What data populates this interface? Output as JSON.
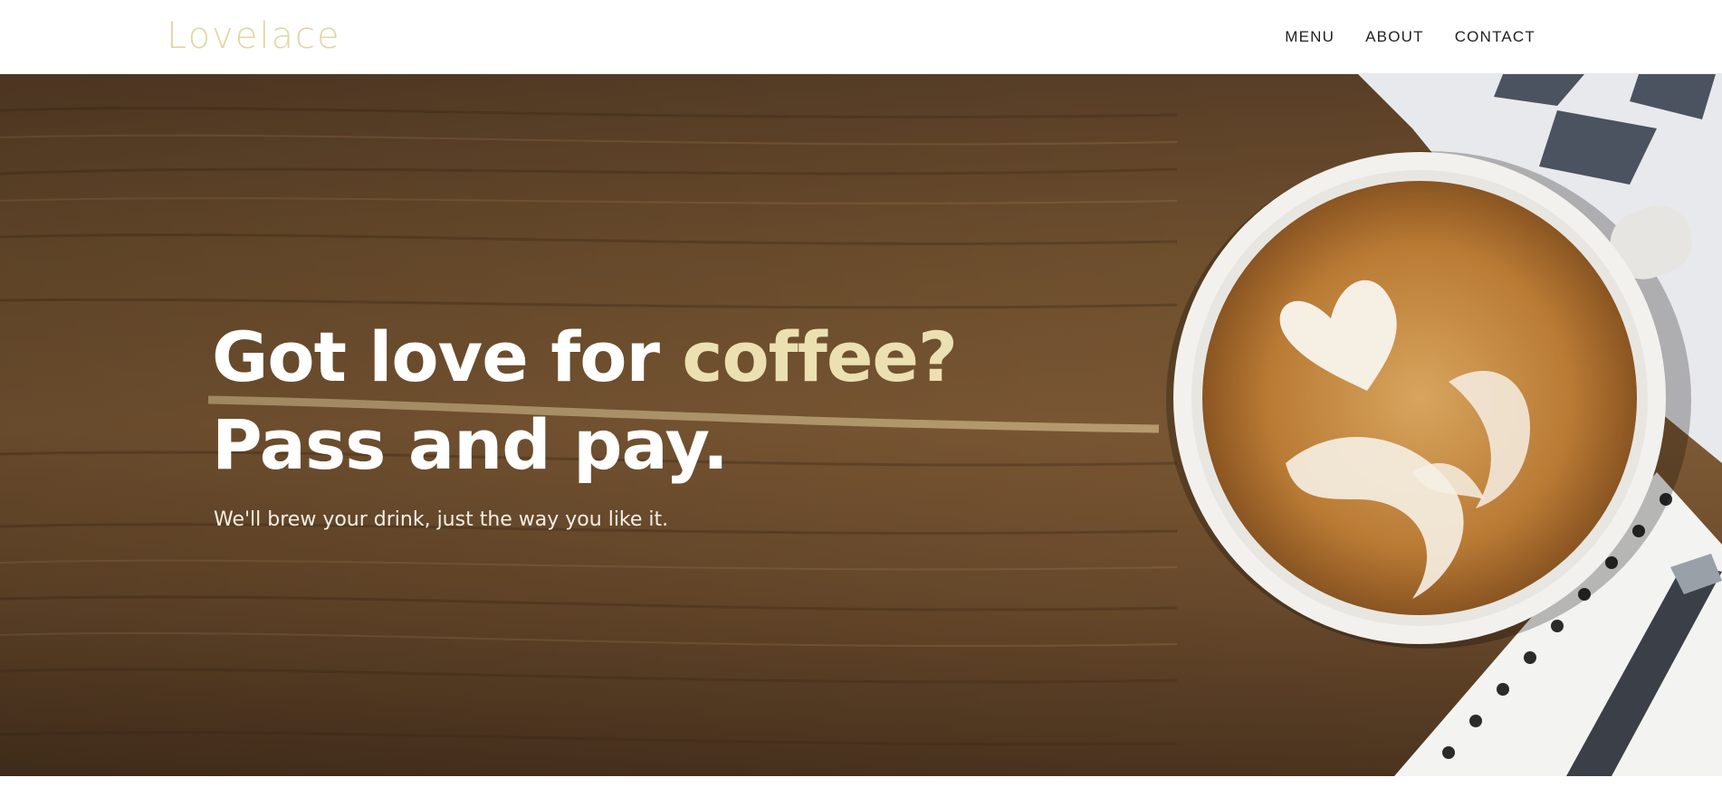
{
  "header": {
    "logo_text": "Lovelace",
    "nav": [
      {
        "label": "MENU"
      },
      {
        "label": "ABOUT"
      },
      {
        "label": "CONTACT"
      }
    ]
  },
  "hero": {
    "headline_part1": "Got love for ",
    "headline_accent": "coffee?",
    "headline_part2": " Pass and pay.",
    "subtitle": "We'll brew your drink, just the way you like it.",
    "image_icon": "latte-art-coffee-cup-image"
  },
  "colors": {
    "logo": "#e3d5a3",
    "accent": "#ebe0b2",
    "nav_text": "#222222",
    "headline": "#ffffff"
  }
}
